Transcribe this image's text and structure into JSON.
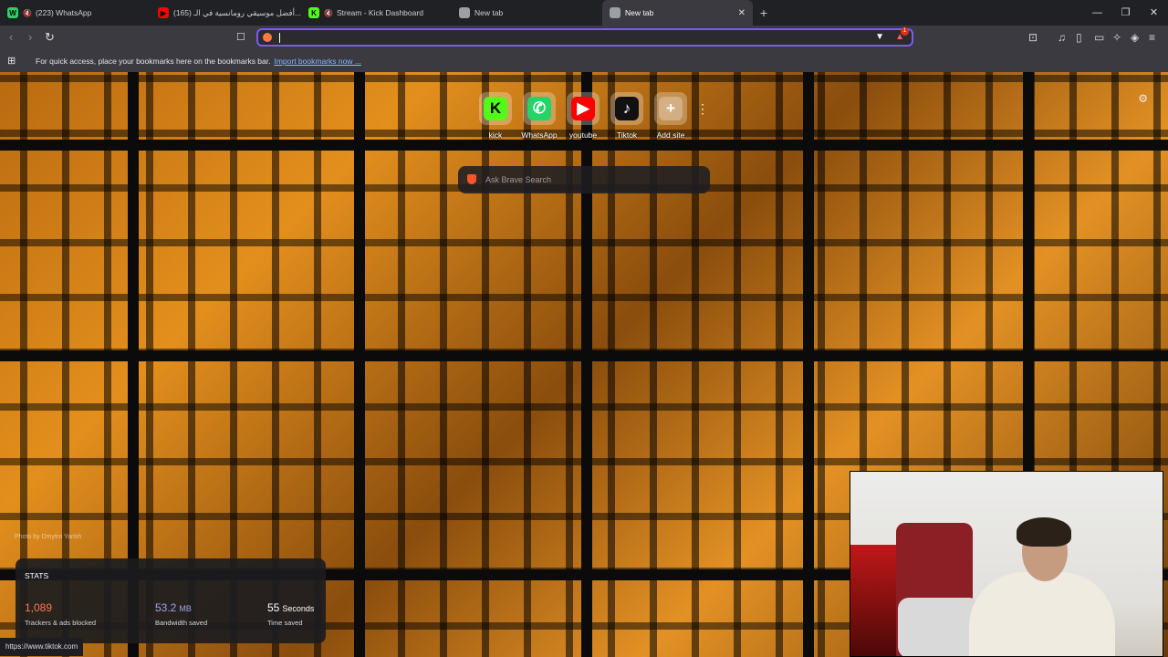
{
  "tabs": [
    {
      "title": "(223) WhatsApp",
      "fav_text": "W",
      "fav_color": "#25d366",
      "muted": true,
      "active": false
    },
    {
      "title": "(165) أفضل موسيقي رومانسية في الـ...",
      "fav_text": "▶",
      "fav_color": "#ff0000",
      "muted": false,
      "active": false
    },
    {
      "title": "Stream - Kick Dashboard",
      "fav_text": "K",
      "fav_color": "#53fc18",
      "muted": true,
      "active": false
    },
    {
      "title": "New tab",
      "fav_text": "",
      "fav_color": "#9aa0a6",
      "muted": false,
      "active": false
    },
    {
      "title": "New tab",
      "fav_text": "",
      "fav_color": "#9aa0a6",
      "muted": false,
      "active": true
    }
  ],
  "tab_close": "✕",
  "new_tab": "+",
  "window": {
    "minimize": "—",
    "maximize": "❐",
    "close": "✕"
  },
  "toolbar": {
    "back": "‹",
    "forward": "›",
    "reload": "↻",
    "bookmark": "☐"
  },
  "omnibox": {
    "value": "",
    "badge_count": "1"
  },
  "toolbar_icons": [
    "tab-search-icon",
    "music-icon",
    "sidebar-icon",
    "wallet-icon",
    "leo-ai-icon",
    "vpn-icon",
    "menu-icon"
  ],
  "bookmarks_bar": {
    "text": "For quick access, place your bookmarks here on the bookmarks bar.",
    "link": "Import bookmarks now ..."
  },
  "top_sites": [
    {
      "label": "kick",
      "glyph": "K",
      "bg": "#53fc18",
      "fg": "#000"
    },
    {
      "label": "WhatsApp",
      "glyph": "✆",
      "bg": "#25d366",
      "fg": "#fff"
    },
    {
      "label": "youtube",
      "glyph": "▶",
      "bg": "#ff0000",
      "fg": "#fff"
    },
    {
      "label": "Tiktok",
      "glyph": "♪",
      "bg": "#111111",
      "fg": "#fff"
    },
    {
      "label": "Add site",
      "glyph": "+",
      "bg": "rgba(255,255,255,0.28)",
      "fg": "#fff"
    }
  ],
  "search": {
    "placeholder": "Ask Brave Search"
  },
  "photo_credit": "Photo by Dmytro Yarish",
  "stats": {
    "heading": "STATS",
    "items": [
      {
        "value": "1,089",
        "unit": "",
        "desc": "Trackers & ads blocked",
        "color": "#ff7654"
      },
      {
        "value": "53.2",
        "unit": "MB",
        "desc": "Bandwidth saved",
        "color": "#a0a5eb"
      },
      {
        "value": "55",
        "unit": "Seconds",
        "desc": "Time saved",
        "color": "#ffffff"
      }
    ]
  },
  "status_url": "https://www.tiktok.com"
}
